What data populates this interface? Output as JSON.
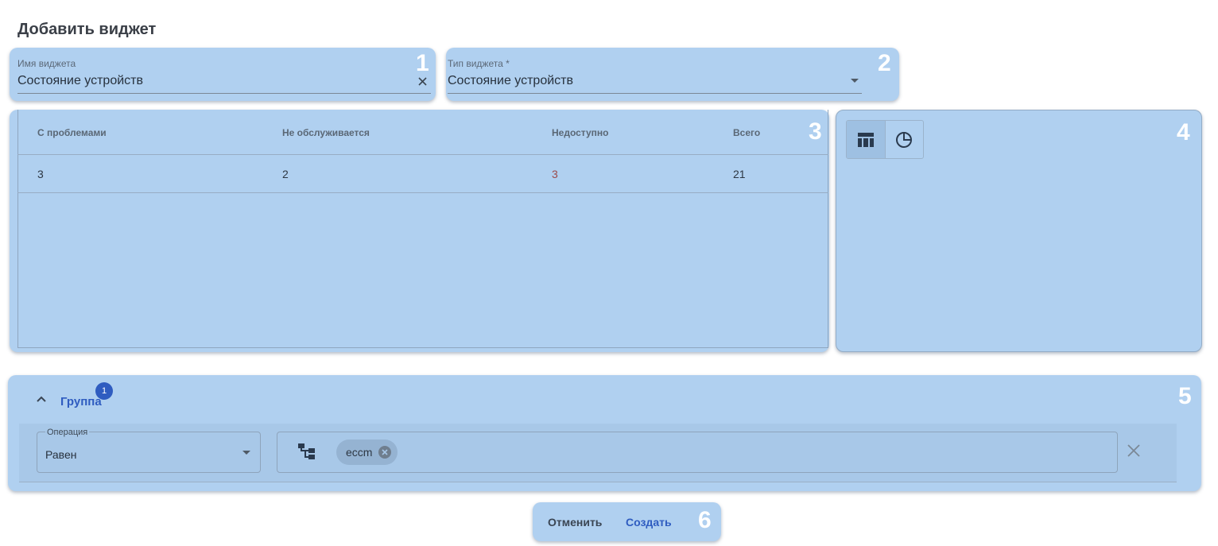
{
  "page": {
    "title": "Добавить виджет"
  },
  "widget_name": {
    "label": "Имя виджета",
    "value": "Состояние устройств",
    "number": "1"
  },
  "widget_type": {
    "label": "Тип виджета *",
    "value": "Состояние устройств",
    "number": "2"
  },
  "preview": {
    "number": "3",
    "columns": [
      "С проблемами",
      "Не обслуживается",
      "Недоступно",
      "Всего"
    ],
    "row": [
      "3",
      "2",
      "3",
      "21"
    ],
    "alert_color": "#9b4a4a"
  },
  "view_mode": {
    "number": "4",
    "options": [
      {
        "icon": "table-icon",
        "active": true
      },
      {
        "icon": "pie-chart-icon",
        "active": false
      }
    ]
  },
  "group_filter": {
    "number": "5",
    "title": "Группа",
    "badge": "1",
    "operation": {
      "label": "Операция",
      "value": "Равен"
    },
    "chips": [
      "eccm"
    ]
  },
  "actions": {
    "number": "6",
    "cancel": "Отменить",
    "create": "Создать"
  },
  "colors": {
    "panel": "#b0d0f0",
    "accent": "#2f5cc0"
  }
}
